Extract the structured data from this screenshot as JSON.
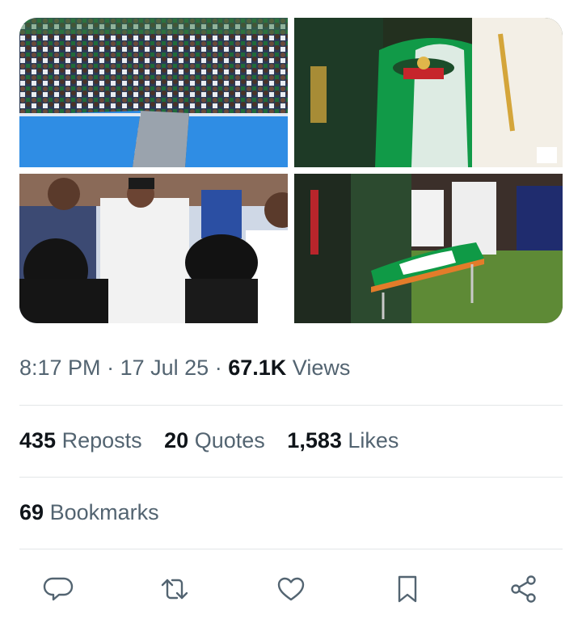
{
  "tweet": {
    "media": [
      {
        "alt": ""
      },
      {
        "alt": ""
      },
      {
        "alt": ""
      },
      {
        "alt": ""
      }
    ],
    "time": "8:17 PM",
    "date": "17 Jul 25",
    "views_count": "67.1K",
    "views_label": "Views",
    "separator": "·"
  },
  "stats": {
    "reposts_count": "435",
    "reposts_label": "Reposts",
    "quotes_count": "20",
    "quotes_label": "Quotes",
    "likes_count": "1,583",
    "likes_label": "Likes",
    "bookmarks_count": "69",
    "bookmarks_label": "Bookmarks"
  },
  "actions": [
    {
      "icon": "reply-icon"
    },
    {
      "icon": "repost-icon"
    },
    {
      "icon": "like-icon"
    },
    {
      "icon": "bookmark-icon"
    },
    {
      "icon": "share-icon"
    }
  ],
  "colors": {
    "text_primary": "#0f1419",
    "text_secondary": "#536471",
    "divider": "#e3e6e8",
    "flag_green": "#0a8a3a"
  }
}
